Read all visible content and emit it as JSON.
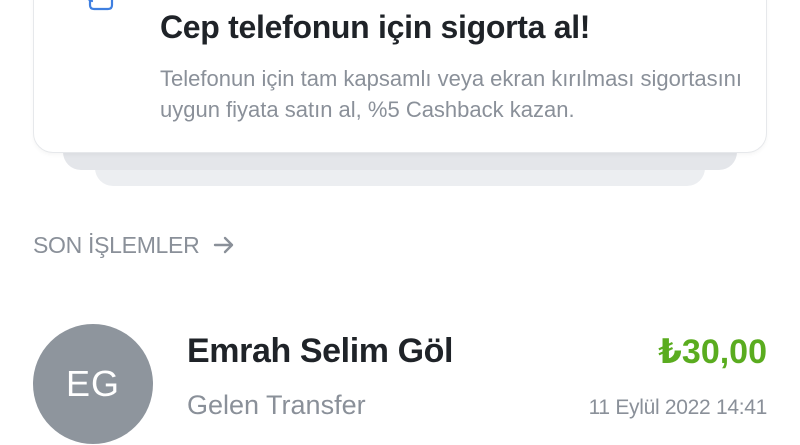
{
  "promo": {
    "title": "Cep telefonun için sigorta al!",
    "description": "Telefonun için tam kapsamlı veya ekran kırılması sigortasını uygun fiyata satın al, %5 Cashback kazan.",
    "icon": "phone-shield-icon"
  },
  "recent": {
    "section_title": "SON İŞLEMLER",
    "arrow_icon": "arrow-right-icon"
  },
  "transactions": [
    {
      "initials": "EG",
      "name": "Emrah Selim Göl",
      "type": "Gelen Transfer",
      "amount": "₺30,00",
      "date": "11 Eylül 2022 14:41"
    }
  ],
  "colors": {
    "amount_positive": "#5aac1f",
    "avatar_bg": "#8e959d",
    "muted_text": "#8a9099",
    "primary_text": "#1f2328",
    "icon_blue": "#3f7fe0"
  }
}
